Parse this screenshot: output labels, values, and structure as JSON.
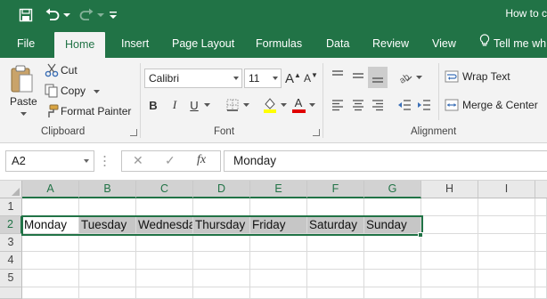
{
  "window": {
    "title": "How to c",
    "quick_access": [
      "save-icon",
      "undo-icon",
      "redo-icon",
      "customize-qat-icon"
    ]
  },
  "tabs": [
    {
      "label": "File"
    },
    {
      "label": "Home"
    },
    {
      "label": "Insert"
    },
    {
      "label": "Page Layout"
    },
    {
      "label": "Formulas"
    },
    {
      "label": "Data"
    },
    {
      "label": "Review"
    },
    {
      "label": "View"
    }
  ],
  "tell_me": "Tell me wh",
  "clipboard": {
    "paste": "Paste",
    "cut": "Cut",
    "copy": "Copy",
    "format_painter": "Format Painter",
    "group": "Clipboard"
  },
  "font": {
    "name": "Calibri",
    "size": "11",
    "bold": "B",
    "italic": "I",
    "underline": "U",
    "font_color_glyph": "A",
    "grow_glyph": "A",
    "shrink_glyph": "A",
    "group": "Font"
  },
  "alignment": {
    "wrap_text": "Wrap Text",
    "merge_center": "Merge & Center",
    "group": "Alignment"
  },
  "formula_bar": {
    "name_box": "A2",
    "cancel": "✕",
    "enter": "✓",
    "fx": "fx",
    "value": "Monday"
  },
  "sheet": {
    "columns": [
      "A",
      "B",
      "C",
      "D",
      "E",
      "F",
      "G",
      "H",
      "I"
    ],
    "rows": [
      "1",
      "2",
      "3",
      "4",
      "5"
    ],
    "row2": [
      "Monday",
      "Tuesday",
      "Wednesday",
      "Thursday",
      "Friday",
      "Saturday",
      "Sunday",
      "",
      ""
    ]
  },
  "colors": {
    "accent": "#217346",
    "selection_fill": "#c6c6c6",
    "highlight_yellow": "#ffff00",
    "font_red": "#e00000"
  }
}
